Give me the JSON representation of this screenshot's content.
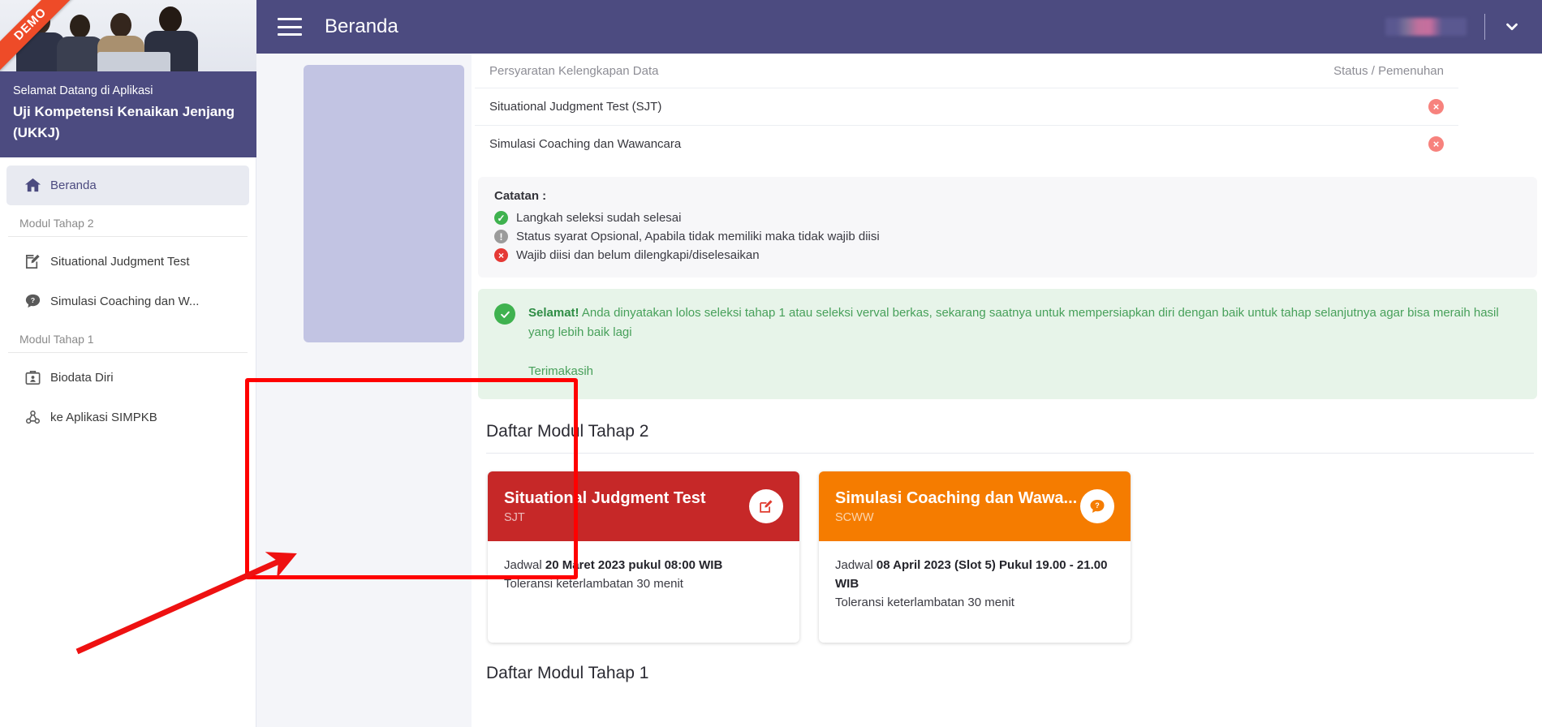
{
  "sidebar": {
    "ribbon": "DEMO",
    "welcome_sub": "Selamat Datang di Aplikasi",
    "welcome_title": "Uji Kompetensi Kenaikan Jenjang (UKKJ)",
    "home_item": {
      "label": "Beranda",
      "icon": "home-icon"
    },
    "group_tahap2": "Modul Tahap 2",
    "group_tahap1": "Modul Tahap 1",
    "items_tahap2": [
      {
        "label": "Situational Judgment Test",
        "icon": "edit-square-icon"
      },
      {
        "label": "Simulasi Coaching dan W...",
        "icon": "question-chat-icon"
      }
    ],
    "items_tahap1": [
      {
        "label": "Biodata Diri",
        "icon": "id-badge-icon"
      },
      {
        "label": "ke Aplikasi SIMPKB",
        "icon": "webhook-icon"
      }
    ]
  },
  "appbar": {
    "menu_icon": "hamburger-icon",
    "title": "Beranda",
    "chevron_icon": "chevron-down-icon"
  },
  "table": {
    "header_left": "Persyaratan Kelengkapan Data",
    "header_right": "Status / Pemenuhan",
    "rows": [
      {
        "name": "Situational Judgment Test (SJT)",
        "status": "×"
      },
      {
        "name": "Simulasi Coaching dan Wawancara",
        "status": "×"
      }
    ]
  },
  "catatan": {
    "title": "Catatan :",
    "lines": [
      {
        "mark": "✓",
        "type": "ok",
        "text": "Langkah seleksi sudah selesai"
      },
      {
        "mark": "!",
        "type": "info",
        "text": "Status syarat Opsional, Apabila tidak memiliki maka tidak wajib diisi"
      },
      {
        "mark": "×",
        "type": "err",
        "text": "Wajib diisi dan belum dilengkapi/diselesaikan"
      }
    ]
  },
  "alert": {
    "icon": "check-circle-icon",
    "strong": "Selamat!",
    "body": " Anda dinyatakan lolos seleksi tahap 1 atau seleksi verval berkas, sekarang saatnya untuk mempersiapkan diri dengan baik untuk tahap selanjutnya agar bisa meraih hasil yang lebih baik lagi",
    "thanks": "Terimakasih"
  },
  "modules": {
    "section_title": "Daftar Modul Tahap 2",
    "bottom_section_title": "Daftar Modul Tahap 1",
    "cards": [
      {
        "title": "Situational Judgment Test",
        "code": "SJT",
        "icon": "edit-square-icon",
        "color": "#c62828",
        "schedule_prefix": "Jadwal ",
        "schedule_value": "20 Maret 2023 pukul 08:00 WIB",
        "tolerance": "Toleransi keterlambatan 30 menit"
      },
      {
        "title": "Simulasi Coaching dan Wawa...",
        "code": "SCWW",
        "icon": "question-chat-icon",
        "color": "#f57c00",
        "schedule_prefix": "Jadwal ",
        "schedule_value": "08 April 2023 (Slot 5) Pukul 19.00 - 21.00 WIB",
        "tolerance": "Toleransi keterlambatan 30 menit"
      }
    ]
  },
  "annotations": {
    "highlight_color": "#ff0000",
    "arrow_color": "#ee1111"
  }
}
